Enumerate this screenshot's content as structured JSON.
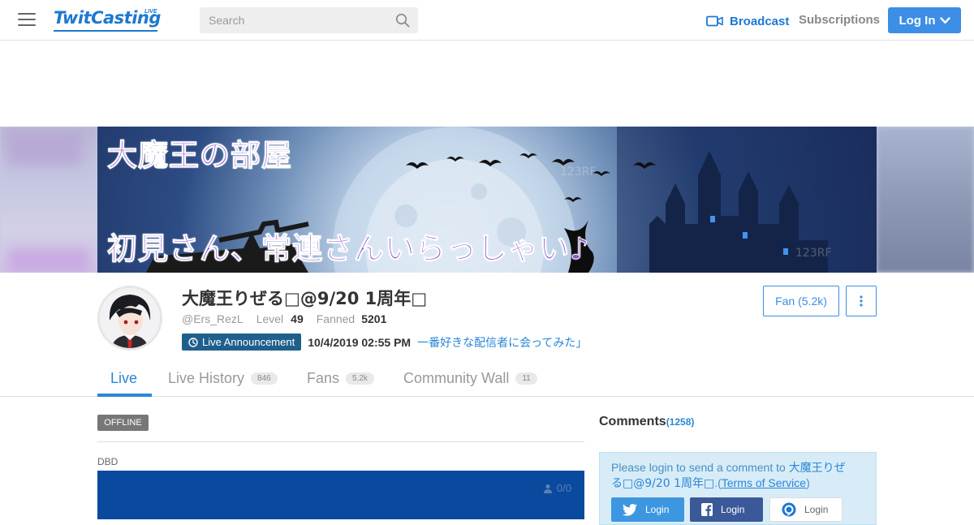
{
  "header": {
    "logo_text": "TwitCasting",
    "logo_badge": "LIVE",
    "search_placeholder": "Search",
    "broadcast_label": "Broadcast",
    "subscriptions_label": "Subscriptions",
    "login_label": "Log In",
    "accent_color": "#1e78d2"
  },
  "banner": {
    "title": "大魔王の部屋",
    "subtitle": "初見さん、常連さんいらっしゃい♪"
  },
  "profile": {
    "name": "大魔王りぜる□@9/20 1周年□",
    "handle": "@Ers_RezL",
    "level_label": "Level",
    "level_value": "49",
    "fanned_label": "Fanned",
    "fanned_value": "5201",
    "announcement_label": "Live Announcement",
    "announcement_date": "10/4/2019 02:55 PM",
    "announcement_title": "一番好きな配信者に会ってみた」",
    "fan_button": "Fan (5.2k)"
  },
  "tabs": [
    {
      "label": "Live",
      "count": ""
    },
    {
      "label": "Live History",
      "count": "846"
    },
    {
      "label": "Fans",
      "count": "5.2k"
    },
    {
      "label": "Community Wall",
      "count": "11"
    }
  ],
  "main": {
    "status_badge": "OFFLINE",
    "category": "DBD",
    "viewers": "0/0"
  },
  "comments": {
    "title": "Comments",
    "count": "(1258)",
    "prompt_prefix": "Please login to send a comment to ",
    "prompt_name": "大魔王りぜる□@9/20 1周年□",
    "prompt_tos_open": ".(",
    "tos_label": "Terms of Service",
    "prompt_tos_close": ")",
    "login_twitter": "Login",
    "login_facebook": "Login",
    "login_twitcas": "Login"
  }
}
